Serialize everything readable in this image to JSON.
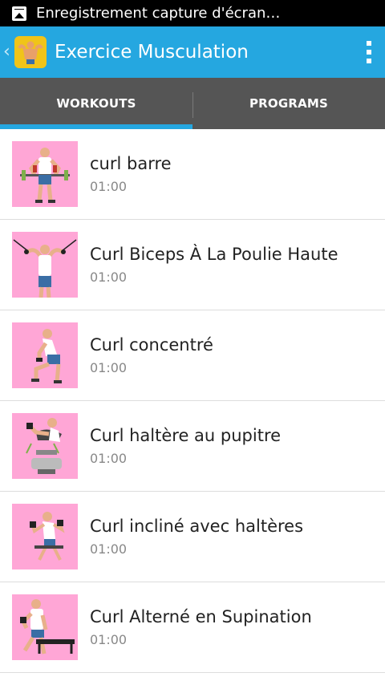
{
  "status_bar": {
    "notification_icon": "screenshot-icon",
    "text": "Enregistrement capture d'écran…"
  },
  "action_bar": {
    "app_icon": "muscle-man-icon",
    "title": "Exercice Musculation",
    "menu_icon": "overflow-menu-icon"
  },
  "tabs": [
    {
      "label": "WORKOUTS",
      "active": true
    },
    {
      "label": "PROGRAMS",
      "active": false
    }
  ],
  "workouts": [
    {
      "title": "curl barre",
      "duration": "01:00",
      "icon": "barbell-curl-illustration"
    },
    {
      "title": "Curl Biceps À La Poulie Haute",
      "duration": "01:00",
      "icon": "cable-curl-illustration"
    },
    {
      "title": "Curl concentré",
      "duration": "01:00",
      "icon": "concentration-curl-illustration"
    },
    {
      "title": "Curl haltère au pupitre",
      "duration": "01:00",
      "icon": "preacher-curl-illustration"
    },
    {
      "title": "Curl incliné avec haltères",
      "duration": "01:00",
      "icon": "incline-curl-illustration"
    },
    {
      "title": "Curl Alterné en Supination",
      "duration": "01:00",
      "icon": "alternate-curl-illustration"
    }
  ],
  "colors": {
    "action_bar": "#25a7e0",
    "tab_bar": "#555555",
    "tab_indicator": "#25a7e0",
    "thumbnail_bg": "#ffa6d6"
  }
}
